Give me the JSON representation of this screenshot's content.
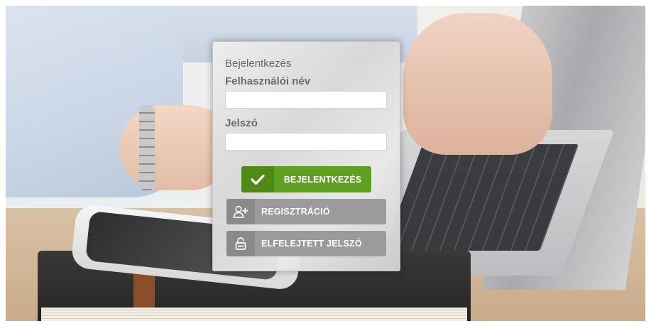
{
  "login": {
    "title": "Bejelentkezés",
    "username_label": "Felhasználói név",
    "username_value": "",
    "password_label": "Jelszó",
    "password_value": "",
    "login_button": "BEJELENTKEZÉS",
    "register_button": "REGISZTRÁCIÓ",
    "forgot_button": "ELFELEJTETT JELSZÓ"
  },
  "icons": {
    "login": "checkmark-icon",
    "register": "add-user-icon",
    "forgot": "unlock-icon"
  },
  "colors": {
    "login_button": "#5f9f21",
    "secondary_button": "#9b9b9b",
    "label_text": "#6b6b6b"
  }
}
